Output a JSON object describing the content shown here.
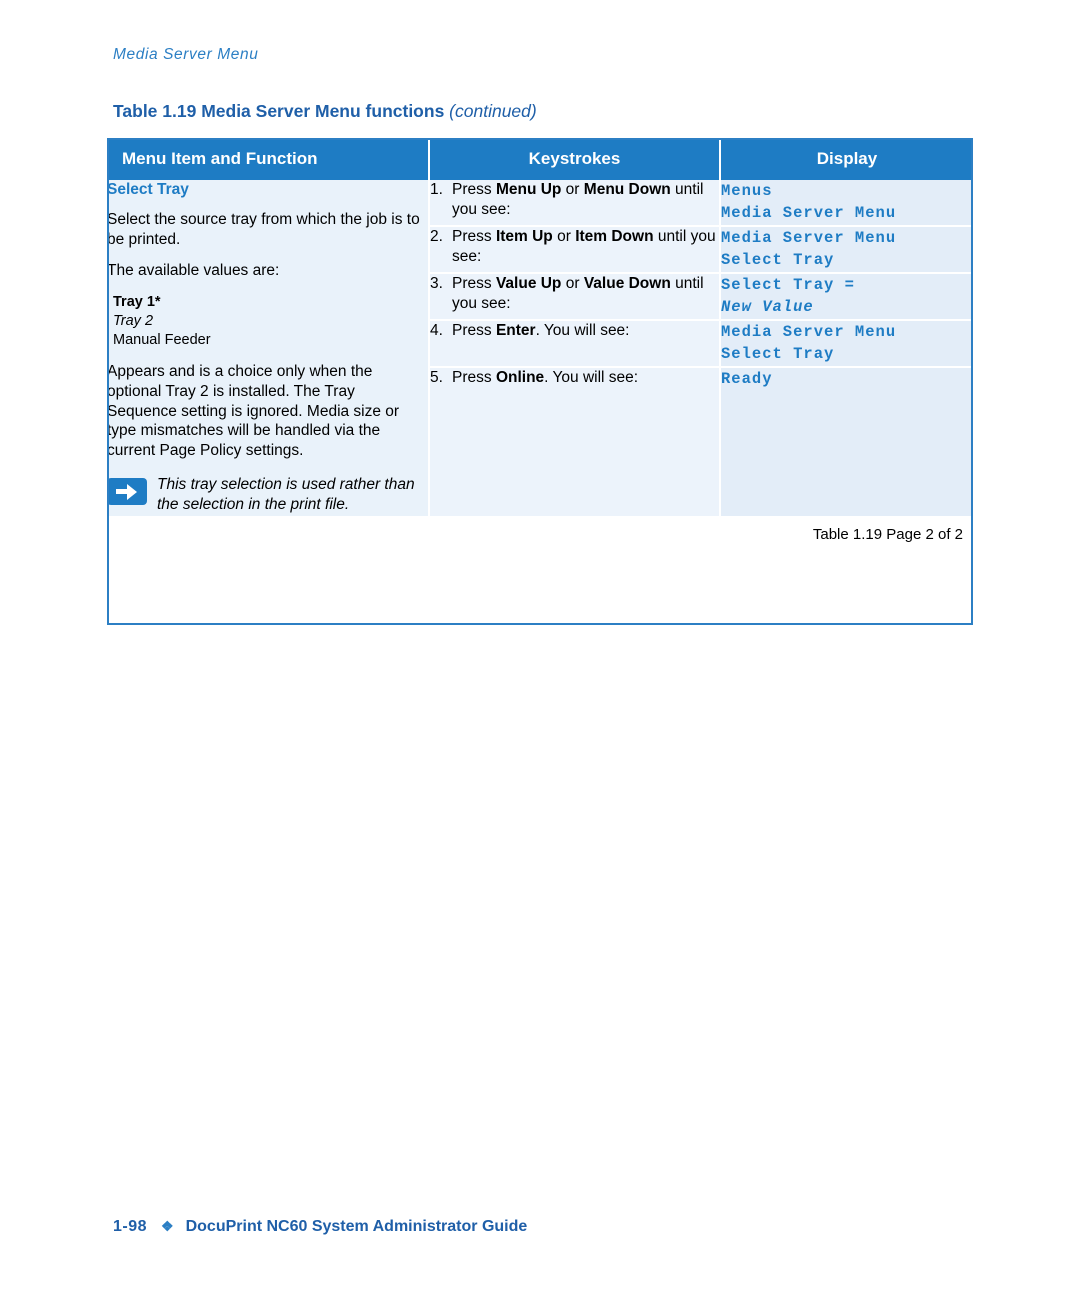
{
  "running_header": "Media Server Menu",
  "table_caption": {
    "main": "Table 1.19  Media Server Menu functions ",
    "continued": "(continued)"
  },
  "header_row": {
    "col1": "Menu Item and Function",
    "col2": "Keystrokes",
    "col3": "Display"
  },
  "left_column": {
    "title": "Select Tray",
    "para1": "Select the source tray from which the job is to be printed.",
    "para2": "The available values are:",
    "values": {
      "v1": "Tray 1*",
      "v2": "Tray 2",
      "v3": "Manual Feeder"
    },
    "para3": "Appears and is a choice only when the optional Tray 2 is installed. The Tray Sequence setting is ignored. Media size or type mismatches will be handled via the current Page Policy settings.",
    "note_icon": "note-arrow-icon",
    "note": "This tray selection is used rather than the selection in the print file."
  },
  "steps": [
    {
      "num": "1.",
      "text_pre": "Press ",
      "bold1": "Menu Up",
      "mid": " or ",
      "bold2": "Menu Down",
      "text_post": " until you see:",
      "display_line1": "Menus",
      "display_line2": "Media Server Menu",
      "display_line2_italic": false
    },
    {
      "num": "2.",
      "text_pre": "Press ",
      "bold1": "Item Up",
      "mid": " or ",
      "bold2": "Item Down",
      "text_post": " until you see:",
      "display_line1": "Media Server Menu",
      "display_line2": "Select Tray",
      "display_line2_italic": false
    },
    {
      "num": "3.",
      "text_pre": "Press ",
      "bold1": "Value Up",
      "mid": " or ",
      "bold2": "Value Down",
      "text_post": " until you see:",
      "display_line1": "Select Tray    =",
      "display_line2": "New Value",
      "display_line2_italic": true
    },
    {
      "num": "4.",
      "text_pre": "Press ",
      "bold1": "Enter",
      "mid": "",
      "bold2": "",
      "text_post": ". You will see:",
      "display_line1": "Media Server Menu",
      "display_line2": "Select Tray",
      "display_line2_italic": false
    },
    {
      "num": "5.",
      "text_pre": "Press ",
      "bold1": "Online",
      "mid": "",
      "bold2": "",
      "text_post": ". You will see:",
      "display_line1": "Ready",
      "display_line2": "",
      "display_line2_italic": false
    }
  ],
  "table_footer": "Table 1.19  Page 2 of 2",
  "page_footer": {
    "page_number": "1-98",
    "diamond": "❖",
    "title": "DocuPrint NC60 System Administrator Guide"
  }
}
